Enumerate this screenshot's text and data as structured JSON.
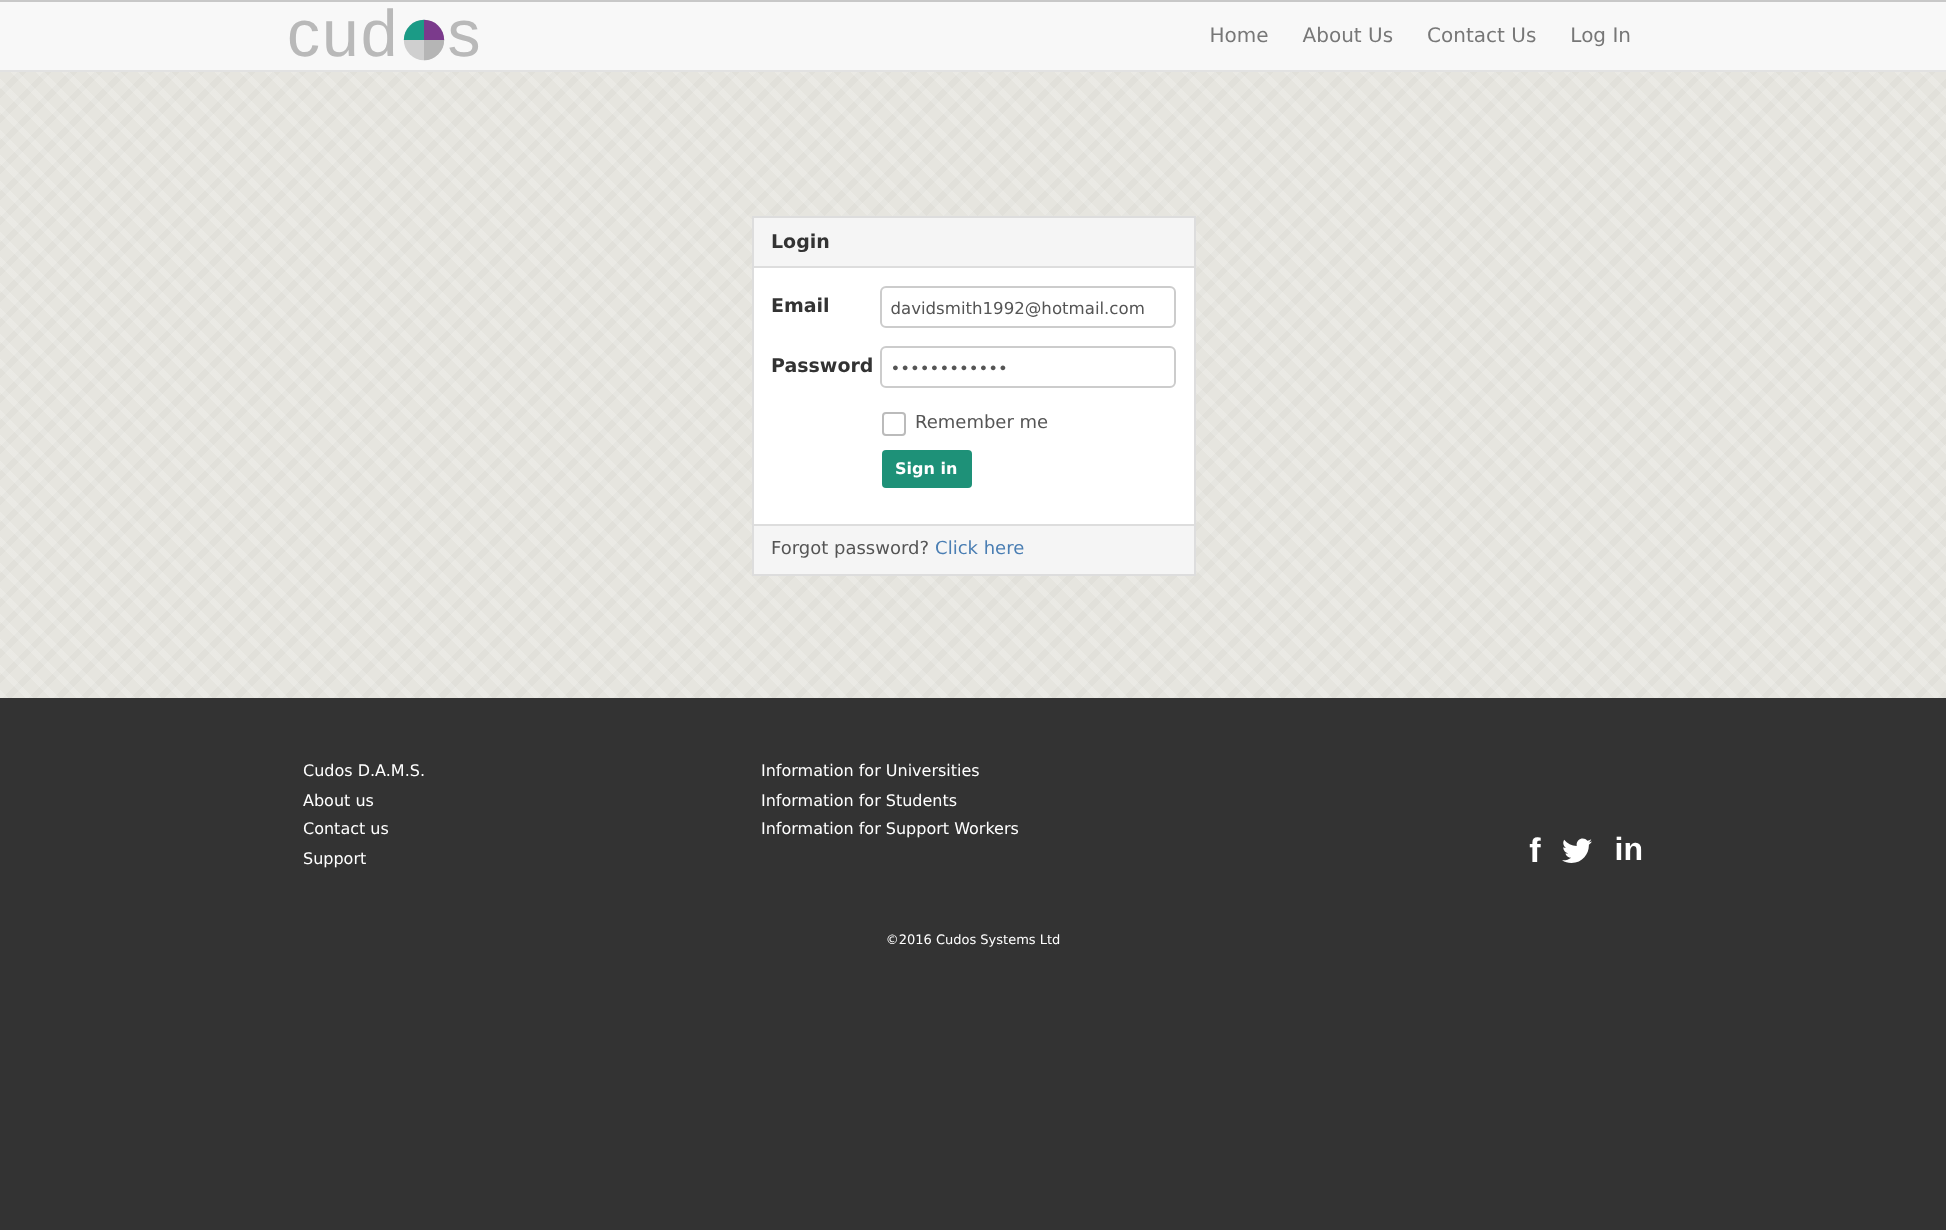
{
  "logo": {
    "prefix": "cud",
    "suffix": "s"
  },
  "nav": [
    {
      "label": "Home"
    },
    {
      "label": "About Us"
    },
    {
      "label": "Contact Us"
    },
    {
      "label": "Log In"
    }
  ],
  "login": {
    "title": "Login",
    "email_label": "Email",
    "email_value": "davidsmith1992@hotmail.com",
    "password_label": "Password",
    "password_value": "••••••••••••",
    "remember": {
      "label": "Remember me",
      "checked": false
    },
    "submit": "Sign in",
    "forgot_text": "Forgot password?",
    "forgot_link": "Click here"
  },
  "footer": {
    "column_1": [
      "Cudos D.A.M.S.",
      "About us",
      "Contact us",
      "Support"
    ],
    "column_2": [
      "Information for Universities",
      "Information for Students",
      "Information for Support Workers"
    ],
    "social": [
      {
        "kind": "facebook",
        "glyph": "f"
      },
      {
        "kind": "twitter"
      },
      {
        "kind": "linkedin",
        "glyph": "in"
      }
    ],
    "copyright": "©2016 Cudos Systems Ltd"
  }
}
